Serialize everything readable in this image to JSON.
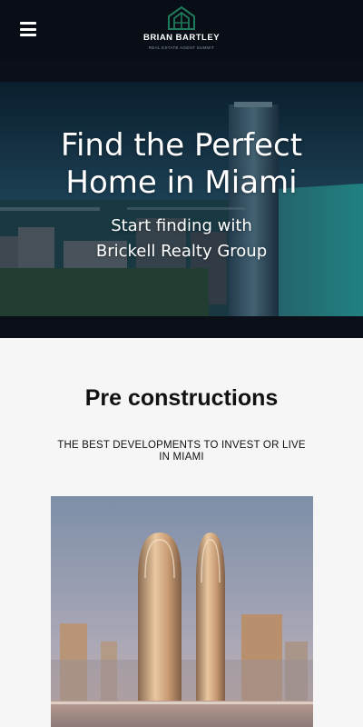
{
  "header": {
    "menu_icon": "hamburger-menu-icon",
    "logo": {
      "icon": "house-logo-icon",
      "name": "BRIAN BARTLEY",
      "tagline": "REAL ESTATE AGENT SUMMIT"
    },
    "accent_color": "#1f7a5a"
  },
  "hero": {
    "title": "Find the Perfect Home in Miami",
    "subtitle": "Start finding with Brickell Realty Group"
  },
  "section": {
    "title": "Pre constructions",
    "subtitle": "THE BEST DEVELOPMENTS TO INVEST OR LIVE IN MIAMI"
  }
}
